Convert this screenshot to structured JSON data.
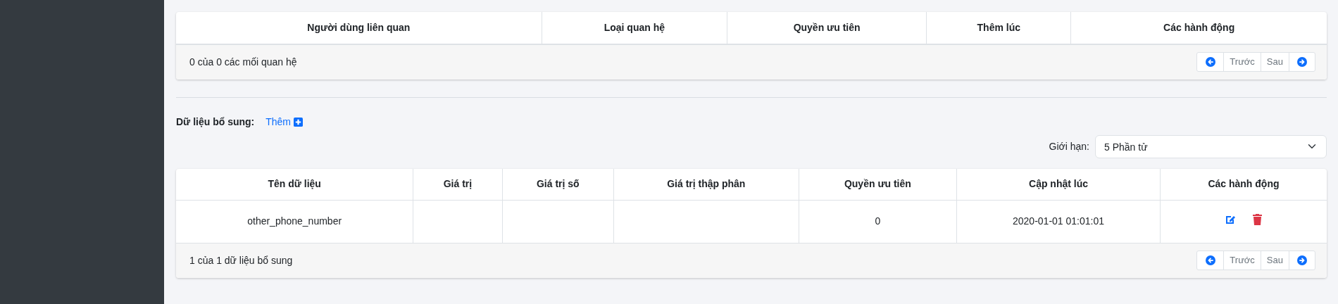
{
  "relations_table": {
    "columns": [
      "Người dùng liên quan",
      "Loại quan hệ",
      "Quyền ưu tiên",
      "Thêm lúc",
      "Các hành động"
    ],
    "summary": "0 của 0 các mối quan hệ",
    "pagination": {
      "previous": "Trước",
      "next": "Sau"
    }
  },
  "extra_data": {
    "title": "Dữ liệu bổ sung:",
    "add_link": "Thêm",
    "limit": {
      "label": "Giới hạn:",
      "value": "5 Phần tử"
    },
    "table": {
      "columns": [
        "Tên dữ liệu",
        "Giá trị",
        "Giá trị số",
        "Giá trị thập phân",
        "Quyền ưu tiên",
        "Cập nhật lúc",
        "Các hành động"
      ],
      "rows": [
        {
          "cells": [
            "other_phone_number",
            "",
            "",
            "",
            "0",
            "2020-01-01 01:01:01"
          ]
        }
      ],
      "summary": "1 của 1 dữ liệu bổ sung",
      "pagination": {
        "previous": "Trước",
        "next": "Sau"
      }
    }
  }
}
